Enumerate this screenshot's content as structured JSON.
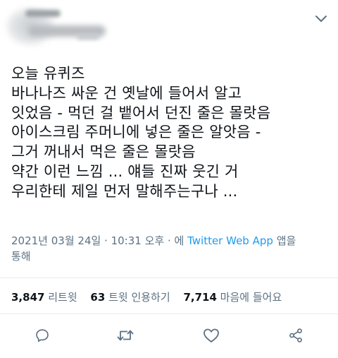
{
  "tweet": {
    "body_lines": [
      "오늘 유퀴즈",
      "바나나즈 싸운 건 옛날에 들어서 알고",
      "잇었음 - 먹던 걸 뱉어서 던진 줄은 몰랏음",
      "아이스크림 주머니에 넣은 줄은 알앗음 -",
      "그거 꺼내서 먹은 줄은 몰랏음",
      "약간 이런 느낌 ... 얘들 진짜 웃긴 거",
      "우리한테 제일 먼저 말해주는구나 ..."
    ],
    "timestamp": "2021년 03월 24일 · 10:31 오후 · 에",
    "source": "Twitter Web App",
    "source_suffix": "앱을",
    "source_suffix2": "통해"
  },
  "stats": {
    "retweets_count": "3,847",
    "retweets_label": "리트윗",
    "quotes_count": "63",
    "quotes_label": "트윗 인용하기",
    "likes_count": "7,714",
    "likes_label": "마음에 들어요"
  },
  "actions": {
    "reply_icon": "reply-icon",
    "retweet_icon": "retweet-icon",
    "like_icon": "heart-icon",
    "share_icon": "share-icon"
  },
  "colors": {
    "text": "#0f1419",
    "secondary": "#5b7083",
    "link": "#1d9bf0",
    "divider": "#e6ecf0"
  }
}
